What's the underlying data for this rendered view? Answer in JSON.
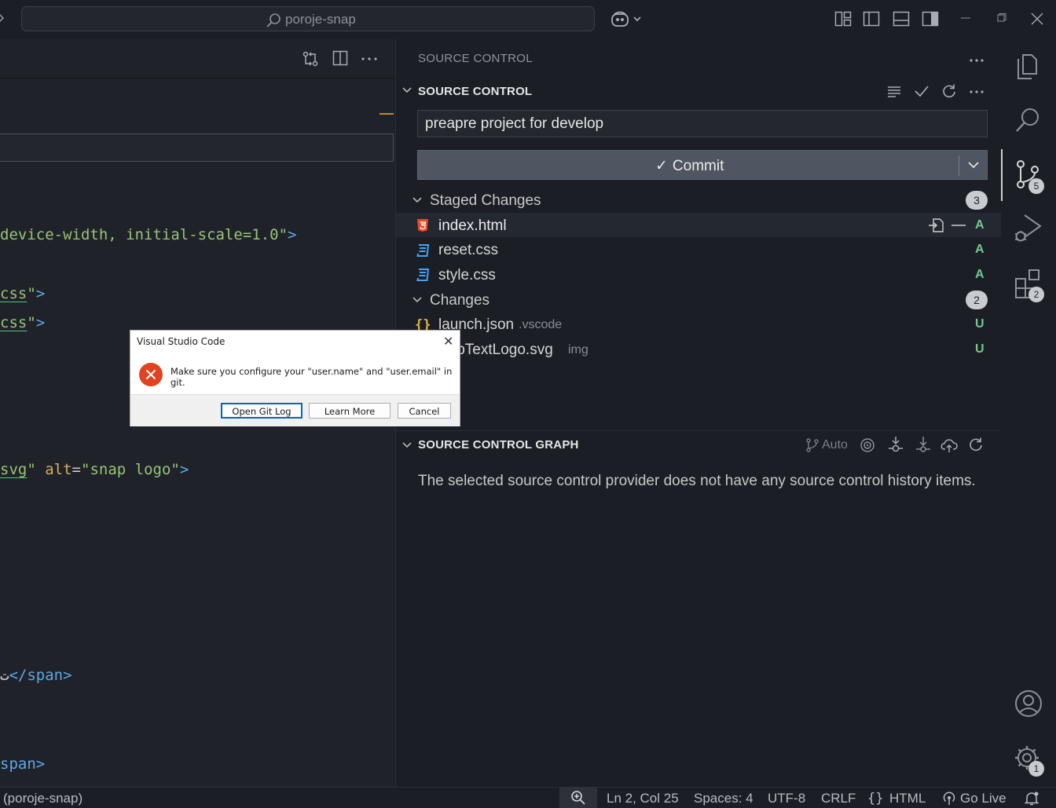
{
  "window": {
    "search_text": "poroje-snap"
  },
  "editor": {
    "code_lines": [
      {
        "parts": [
          {
            "t": "device-width, initial-scale=1.0\"",
            "c": "str"
          },
          {
            "t": ">",
            "c": "tag"
          }
        ]
      },
      {
        "parts": [
          {
            "t": "css",
            "c": "str",
            "u": true
          },
          {
            "t": "\"",
            "c": "str"
          },
          {
            "t": ">",
            "c": "tag"
          }
        ]
      },
      {
        "parts": [
          {
            "t": "css",
            "c": "str",
            "u": true
          },
          {
            "t": "\"",
            "c": "str"
          },
          {
            "t": ">",
            "c": "tag"
          }
        ]
      },
      {
        "parts": [
          {
            "t": "svg",
            "c": "str",
            "u": true
          },
          {
            "t": "\" ",
            "c": "str"
          },
          {
            "t": "alt",
            "c": "attr"
          },
          {
            "t": "=",
            "c": "punc"
          },
          {
            "t": "\"snap logo\"",
            "c": "str"
          },
          {
            "t": ">",
            "c": "tag"
          }
        ]
      },
      {
        "parts": [
          {
            "t": "ت",
            "c": "punc"
          },
          {
            "t": "</span>",
            "c": "tag"
          }
        ]
      },
      {
        "parts": [
          {
            "t": "span>",
            "c": "tag"
          }
        ]
      }
    ]
  },
  "dialog": {
    "title": "Visual Studio Code",
    "message": "Make sure you configure your \"user.name\" and \"user.email\" in git.",
    "buttons": [
      "Open Git Log",
      "Learn More",
      "Cancel"
    ]
  },
  "scm": {
    "header": "SOURCE CONTROL",
    "section_title": "SOURCE CONTROL",
    "commit_message": "preapre project for develop",
    "commit_label": "Commit",
    "staged": {
      "label": "Staged Changes",
      "count": "3",
      "files": [
        {
          "name": "index.html",
          "dir": "",
          "status": "A",
          "icon": "html5-icon"
        },
        {
          "name": "reset.css",
          "dir": "",
          "status": "A",
          "icon": "css3-icon"
        },
        {
          "name": "style.css",
          "dir": "",
          "status": "A",
          "icon": "css3-icon"
        }
      ]
    },
    "changes": {
      "label": "Changes",
      "count": "2",
      "files": [
        {
          "name": "launch.json",
          "dir": ".vscode",
          "status": "U",
          "icon": "json-braces-icon"
        },
        {
          "name": "AppTextLogo.svg",
          "dir": "img",
          "status": "U",
          "icon": "svg-icon"
        }
      ]
    },
    "graph": {
      "title": "SOURCE CONTROL GRAPH",
      "auto_label": "Auto",
      "empty_message": "The selected source control provider does not have any source control history items."
    }
  },
  "activity_badges": {
    "scm": "5",
    "extensions": "2",
    "settings": "1"
  },
  "statusbar": {
    "left": "(poroje-snap)",
    "position": "Ln 2, Col 25",
    "spaces": "Spaces: 4",
    "encoding": "UTF-8",
    "eol": "CRLF",
    "language": "HTML",
    "golive": "Go Live"
  }
}
